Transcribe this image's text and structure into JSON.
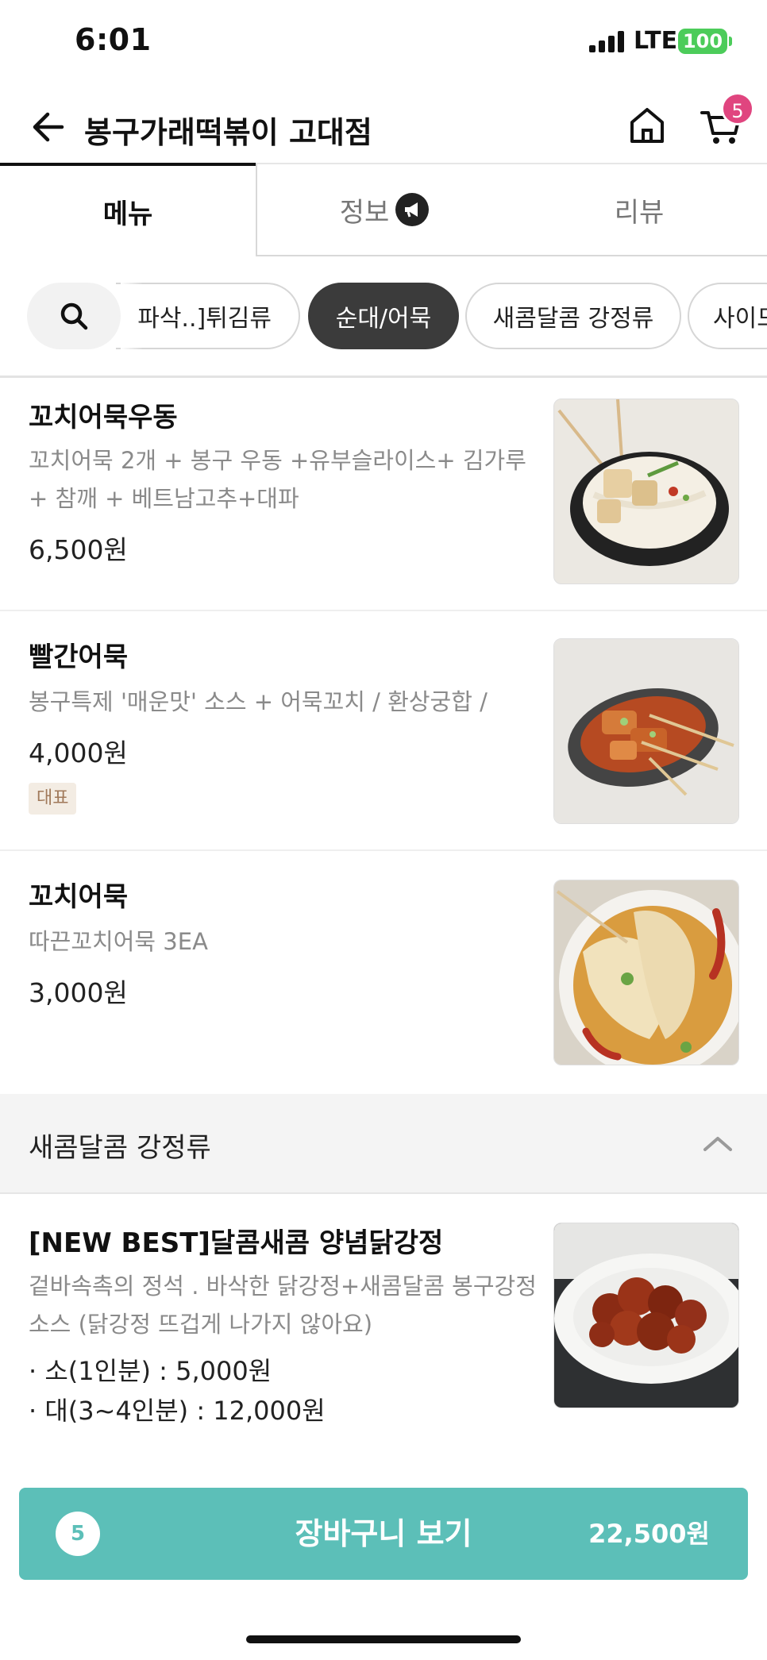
{
  "status": {
    "time": "6:01",
    "network": "LTE",
    "battery": "100"
  },
  "header": {
    "title": "봉구가래떡볶이 고대점",
    "cart_count": "5"
  },
  "tabs": [
    {
      "label": "메뉴",
      "active": true
    },
    {
      "label": "정보",
      "active": false
    },
    {
      "label": "리뷰",
      "active": false
    }
  ],
  "categories": [
    {
      "label": "파삭..]튀김류"
    },
    {
      "label": "순대/어묵",
      "active": true
    },
    {
      "label": "새콤달콤 강정류"
    },
    {
      "label": "사이드"
    }
  ],
  "items": [
    {
      "name": "꼬치어묵우동",
      "desc": "꼬치어묵 2개 + 봉구 우동 +유부슬라이스+ 김가루 + 참깨 + 베트남고추+대파",
      "price": "6,500원"
    },
    {
      "name": "빨간어묵",
      "desc": "봉구특제 '매운맛' 소스 + 어묵꼬치 / 환상궁합 /",
      "price": "4,000원",
      "badge": "대표"
    },
    {
      "name": "꼬치어묵",
      "desc": "따끈꼬치어묵 3EA",
      "price": "3,000원"
    }
  ],
  "section": {
    "title": "새콤달콤 강정류"
  },
  "section_items": [
    {
      "name": "[NEW BEST]달콤새콤 양념닭강정",
      "desc": "겉바속촉의 정석 . 바삭한 닭강정+새콤달콤 봉구강정소스 (닭강정 뜨겁게 나가지 않아요)",
      "options": [
        "· 소(1인분) : 5,000원",
        "· 대(3~4인분) : 12,000원"
      ]
    }
  ],
  "cart_bar": {
    "count": "5",
    "label": "장바구니 보기",
    "total": "22,500원"
  },
  "icons": {
    "back": "arrow-left-icon",
    "home": "home-icon",
    "cart": "cart-icon",
    "search": "search-icon",
    "megaphone": "megaphone-icon",
    "collapse": "chevron-up-icon"
  },
  "colors": {
    "accent": "#5cbfb8",
    "badge": "#e0457f",
    "battery": "#4ccc5a"
  }
}
